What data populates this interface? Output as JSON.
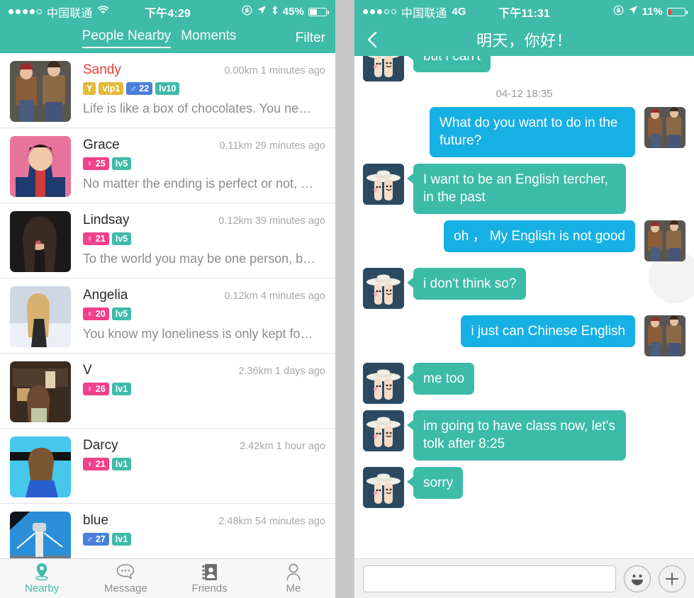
{
  "left": {
    "statusbar": {
      "carrier": "中国联通",
      "network_icon": "wifi-icon",
      "time": "下午4:29",
      "battery_percent": "45%",
      "signal_dots_filled": 4,
      "signal_dots_total": 5,
      "icons": [
        "rotation-lock-icon",
        "location-arrow-icon",
        "bluetooth-icon"
      ]
    },
    "nav": {
      "tabs": [
        {
          "label": "People Nearby",
          "active": true
        },
        {
          "label": "Moments",
          "active": false
        }
      ],
      "filter_label": "Filter"
    },
    "people": [
      {
        "name": "Sandy",
        "name_highlight": true,
        "distance": "0.00km",
        "time": "1 minutes ago",
        "meta": "0.00km 1 minutes ago",
        "badges": [
          {
            "text": "Y",
            "type": "y"
          },
          {
            "text": "vip1",
            "type": "vip"
          },
          {
            "text": "22",
            "type": "male",
            "icon": "♂"
          },
          {
            "text": "lv10",
            "type": "lv"
          }
        ],
        "signature": "Life is like a box of chocolates. You ne…",
        "avatar": "couple-photo"
      },
      {
        "name": "Grace",
        "name_highlight": false,
        "distance": "0.11km",
        "time": "29 minutes ago",
        "meta": "0.11km 29 minutes ago",
        "badges": [
          {
            "text": "25",
            "type": "female",
            "icon": "♀"
          },
          {
            "text": "lv5",
            "type": "lv"
          }
        ],
        "signature": "No matter the ending is perfect or not, …",
        "avatar": "pink-portrait"
      },
      {
        "name": "Lindsay",
        "name_highlight": false,
        "distance": "0.12km",
        "time": "39 minutes ago",
        "meta": "0.12km 39 minutes ago",
        "badges": [
          {
            "text": "21",
            "type": "female",
            "icon": "♀"
          },
          {
            "text": "lv5",
            "type": "lv"
          }
        ],
        "signature": "To the world you may be one person, b…",
        "avatar": "dark-hair-portrait"
      },
      {
        "name": "Angelia",
        "name_highlight": false,
        "distance": "0.12km",
        "time": "4 minutes ago",
        "meta": "0.12km 4 minutes ago",
        "badges": [
          {
            "text": "20",
            "type": "female",
            "icon": "♀"
          },
          {
            "text": "lv5",
            "type": "lv"
          }
        ],
        "signature": "You know my loneliness is only kept fo…",
        "avatar": "blonde-portrait"
      },
      {
        "name": "V",
        "name_highlight": false,
        "distance": "2.36km",
        "time": "1 days ago",
        "meta": "2.36km 1 days ago",
        "badges": [
          {
            "text": "26",
            "type": "female",
            "icon": "♀"
          },
          {
            "text": "lv1",
            "type": "lv"
          }
        ],
        "signature": "",
        "avatar": "cafe-photo"
      },
      {
        "name": "Darcy",
        "name_highlight": false,
        "distance": "2.42km",
        "time": "1 hour ago",
        "meta": "2.42km 1 hour ago",
        "badges": [
          {
            "text": "21",
            "type": "female",
            "icon": "♀"
          },
          {
            "text": "lv1",
            "type": "lv"
          }
        ],
        "signature": "",
        "avatar": "blue-dress-portrait"
      },
      {
        "name": "blue",
        "name_highlight": false,
        "distance": "2.48km",
        "time": "54 minutes ago",
        "meta": "2.48km 54 minutes ago",
        "badges": [
          {
            "text": "27",
            "type": "male",
            "icon": "♂"
          },
          {
            "text": "lv1",
            "type": "lv"
          }
        ],
        "signature": "",
        "avatar": "airport-photo"
      }
    ],
    "tabbar": [
      {
        "label": "Nearby",
        "icon": "location-pin-icon",
        "active": true
      },
      {
        "label": "Message",
        "icon": "chat-bubble-icon",
        "active": false
      },
      {
        "label": "Friends",
        "icon": "contacts-book-icon",
        "active": false
      },
      {
        "label": "Me",
        "icon": "person-icon",
        "active": false
      }
    ]
  },
  "right": {
    "statusbar": {
      "carrier": "中国联通",
      "network_label": "4G",
      "time": "下午11:31",
      "battery_percent": "11%",
      "signal_dots_filled": 3,
      "signal_dots_total": 5,
      "icons": [
        "rotation-lock-icon",
        "location-arrow-icon"
      ]
    },
    "nav": {
      "back_icon": "chevron-left-icon",
      "title": "明天，你好！"
    },
    "messages": [
      {
        "side": "in",
        "text": "but i can't",
        "avatar": "finger-couple"
      },
      {
        "side": "timestamp",
        "text": "04-12 18:35"
      },
      {
        "side": "out",
        "text": "What do you want to do in the future?",
        "avatar": "couple-photo"
      },
      {
        "side": "in",
        "text": "I want to be an English tercher, in the past",
        "avatar": "finger-couple"
      },
      {
        "side": "out",
        "text": "oh ， My English is not good",
        "avatar": "couple-photo"
      },
      {
        "side": "in",
        "text": "i don't think so?",
        "avatar": "finger-couple"
      },
      {
        "side": "out",
        "text": "i just can Chinese English",
        "avatar": "couple-photo"
      },
      {
        "side": "in",
        "text": "me too",
        "avatar": "finger-couple"
      },
      {
        "side": "in",
        "text": "im going to have class now, let's tolk after 8:25",
        "avatar": "finger-couple"
      },
      {
        "side": "in",
        "text": "sorry",
        "avatar": "finger-couple"
      }
    ],
    "input": {
      "value": "",
      "placeholder": "",
      "emoji_icon": "smiley-face-icon",
      "plus_icon": "plus-circle-icon"
    }
  },
  "colors": {
    "accent_teal": "#3fbba9",
    "bubble_in": "#3bbba8",
    "bubble_out": "#16b0e4",
    "badge_male": "#4a80d8",
    "badge_female": "#f0418a",
    "badge_vip": "#e2b93b",
    "name_highlight": "#ee3b30"
  }
}
